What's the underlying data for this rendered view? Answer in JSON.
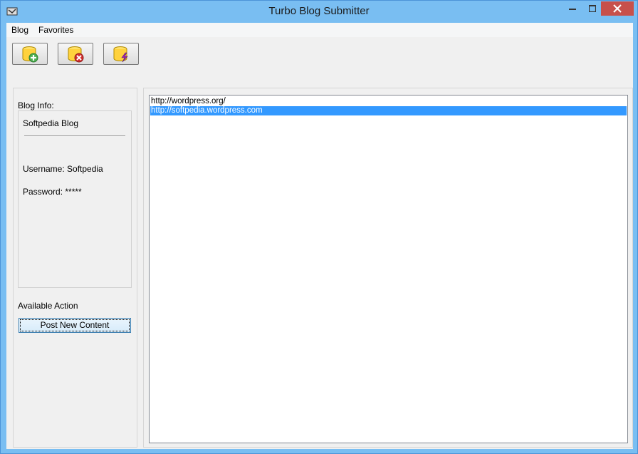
{
  "window": {
    "title": "Turbo Blog Submitter",
    "close_color": "#c7504b"
  },
  "menu": [
    {
      "label": "Blog"
    },
    {
      "label": "Favorites"
    }
  ],
  "toolbar": {
    "buttons": [
      {
        "icon": "database-add-icon"
      },
      {
        "icon": "database-remove-icon"
      },
      {
        "icon": "database-lightning-icon"
      }
    ]
  },
  "blog_info": {
    "heading": "Blog Info:",
    "name": "Softpedia Blog",
    "username": "Username: Softpedia",
    "password": "Password: *****"
  },
  "actions": {
    "heading": "Available Action",
    "post_button": "Post New Content"
  },
  "blog_list": {
    "items": [
      {
        "url": "http://wordpress.org/",
        "selected": false
      },
      {
        "url": "http://softpedia.wordpress.com",
        "selected": true
      }
    ],
    "selection_color": "#3399ff"
  }
}
